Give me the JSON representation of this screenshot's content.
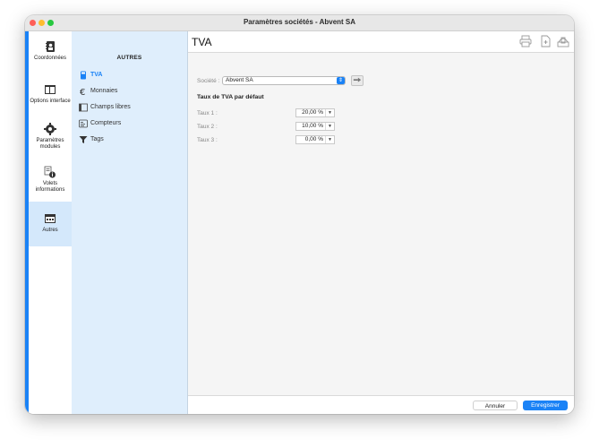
{
  "window": {
    "title": "Paramètres sociétés - Abvent SA"
  },
  "rail": {
    "items": [
      {
        "label": "Coordonnées",
        "icon": "address-book-icon"
      },
      {
        "label": "Options interface",
        "icon": "window-icon"
      },
      {
        "label": "Paramètres modules",
        "icon": "gear-icon"
      },
      {
        "label": "Volets informations",
        "icon": "info-panel-icon"
      },
      {
        "label": "Autres",
        "icon": "folder-grid-icon"
      }
    ]
  },
  "subnav": {
    "header": "AUTRES",
    "items": [
      {
        "label": "TVA",
        "icon": "calculator-icon"
      },
      {
        "label": "Monnaies",
        "icon": "euro-icon"
      },
      {
        "label": "Champs libres",
        "icon": "free-fields-icon"
      },
      {
        "label": "Compteurs",
        "icon": "counter-icon"
      },
      {
        "label": "Tags",
        "icon": "filter-icon"
      }
    ]
  },
  "main": {
    "title": "TVA",
    "company_label": "Société :",
    "company_value": "Abvent SA",
    "section_title": "Taux de TVA par défaut",
    "rates": [
      {
        "label": "Taux 1 :",
        "value": "20,00 %"
      },
      {
        "label": "Taux 2 :",
        "value": "10,00 %"
      },
      {
        "label": "Taux 3 :",
        "value": "0,00 %"
      }
    ]
  },
  "footer": {
    "cancel": "Annuler",
    "save": "Enregistrer"
  },
  "colors": {
    "accent": "#1a82f6",
    "subnav_bg": "#dfeefc"
  }
}
